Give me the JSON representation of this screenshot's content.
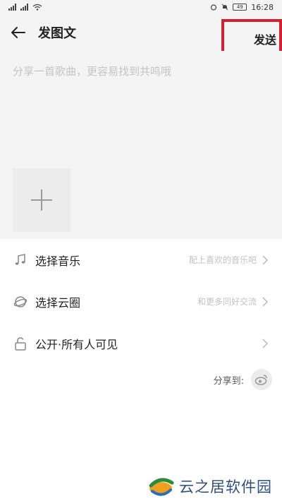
{
  "status_bar": {
    "time": "16:28",
    "battery": "49"
  },
  "header": {
    "title": "发图文",
    "send_label": "发送"
  },
  "editor": {
    "placeholder": "分享一首歌曲，更容易找到共鸣哦"
  },
  "options": [
    {
      "label": "选择音乐",
      "hint": "配上喜欢的音乐吧",
      "icon": "music-note-icon"
    },
    {
      "label": "选择云圈",
      "hint": "和更多同好交流",
      "icon": "cloud-circle-icon"
    },
    {
      "label": "公开·所有人可见",
      "hint": "",
      "icon": "unlock-icon"
    }
  ],
  "share": {
    "label": "分享到:",
    "icon": "weibo-icon"
  },
  "watermark": {
    "text": "云之居软件园"
  },
  "colors": {
    "highlight": "#d42030",
    "background": "#f4f4f4",
    "hint": "#c2c2c2"
  }
}
